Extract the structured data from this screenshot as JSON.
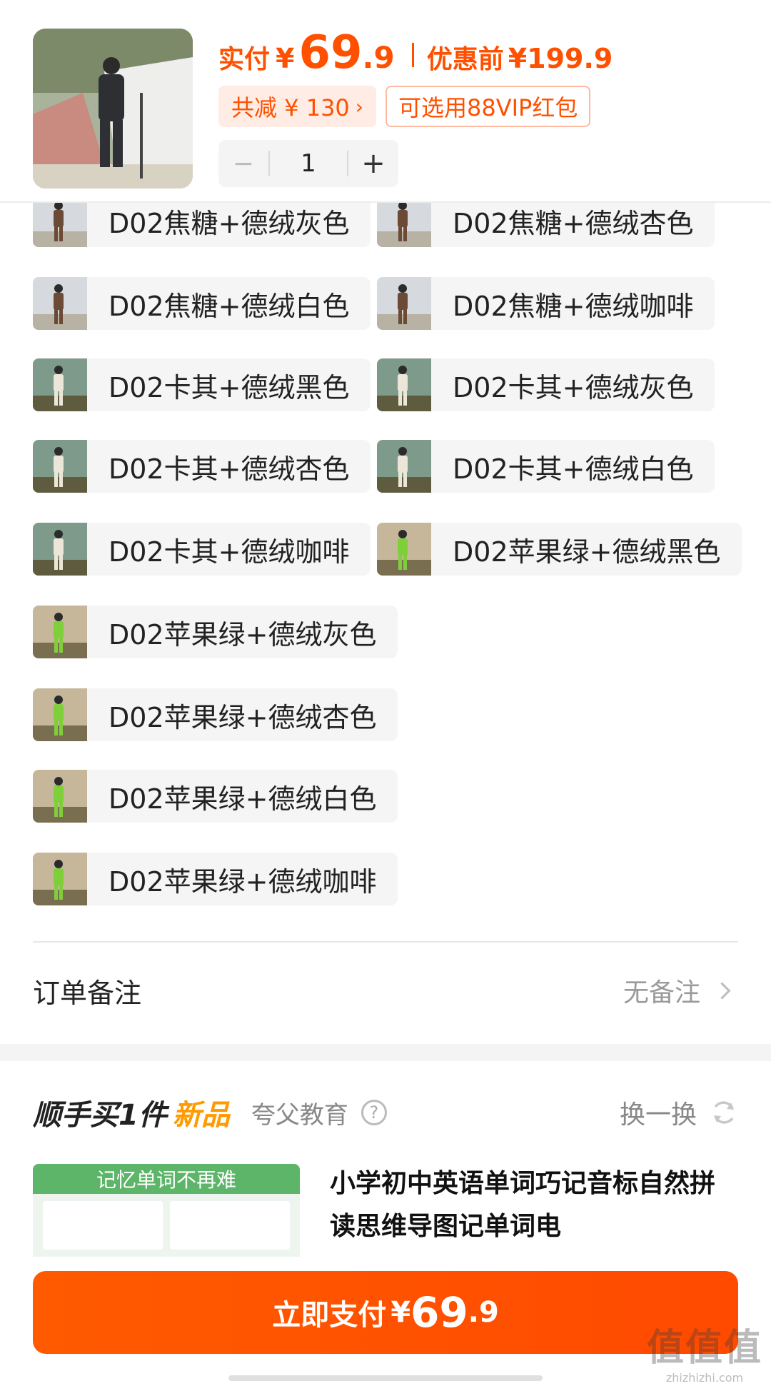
{
  "header": {
    "pay_label": "实付",
    "pay_yen": "¥",
    "pay_int": "69",
    "pay_dec": ".9",
    "orig_label": "优惠前",
    "orig_price": "¥199.9",
    "reduce_tag": "共减 ¥ 130",
    "reduce_chevron": "›",
    "vip_tag": "可选用88VIP红包",
    "stepper": {
      "minus": "−",
      "quantity": "1",
      "plus": "+"
    }
  },
  "options": [
    {
      "label": "D02焦糖+德绒灰色",
      "color": "caramel"
    },
    {
      "label": "D02焦糖+德绒杏色",
      "color": "caramel"
    },
    {
      "label": "D02焦糖+德绒白色",
      "color": "caramel"
    },
    {
      "label": "D02焦糖+德绒咖啡",
      "color": "caramel"
    },
    {
      "label": "D02卡其+德绒黑色",
      "color": "khaki"
    },
    {
      "label": "D02卡其+德绒灰色",
      "color": "khaki"
    },
    {
      "label": "D02卡其+德绒杏色",
      "color": "khaki"
    },
    {
      "label": "D02卡其+德绒白色",
      "color": "khaki"
    },
    {
      "label": "D02卡其+德绒咖啡",
      "color": "khaki"
    },
    {
      "label": "D02苹果绿+德绒黑色",
      "color": "green"
    },
    {
      "label": "D02苹果绿+德绒灰色",
      "color": "green"
    },
    {
      "label": "D02苹果绿+德绒杏色",
      "color": "green"
    },
    {
      "label": "D02苹果绿+德绒白色",
      "color": "green"
    },
    {
      "label": "D02苹果绿+德绒咖啡",
      "color": "green"
    }
  ],
  "remark": {
    "label": "订单备注",
    "value": "无备注"
  },
  "recommend": {
    "title_part1": "顺手买1件",
    "title_part2": "新品",
    "brand": "夸父教育",
    "help_icon": "?",
    "refresh_label": "换一换",
    "card_banner": "记忆单词不再难",
    "description": "小学初中英语单词巧记音标自然拼读思维导图记单词电"
  },
  "pay_button": {
    "label": "立即支付",
    "yen": "¥",
    "int": "69",
    "dec": ".9"
  },
  "watermark": {
    "big": "值值值",
    "small": "zhizhizhi.com"
  },
  "colors": {
    "accent": "#ff5000",
    "chip_bg": "#f5f5f5"
  }
}
